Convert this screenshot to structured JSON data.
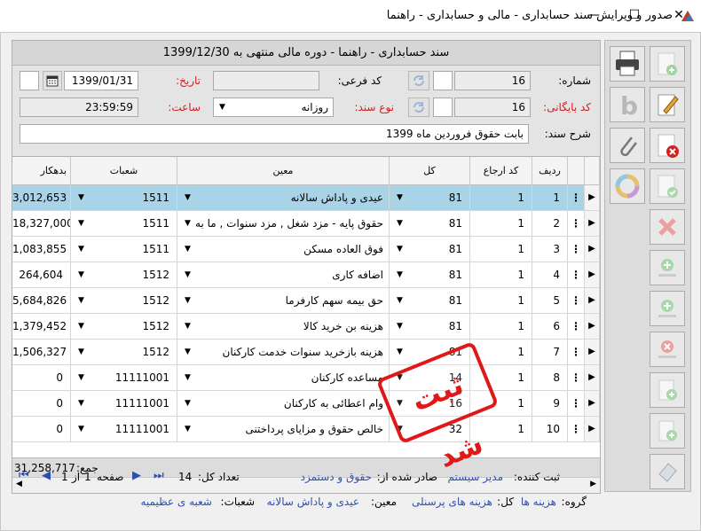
{
  "window": {
    "title": "صدور و ویرایش سند حسابداری - مالی و حسابداری - راهنما",
    "min_glyph": "—",
    "max_glyph": "☐",
    "close_glyph": "✕"
  },
  "header": {
    "title": "سند حسابداری  -  راهنما  -  دوره مالی منتهی به 1399/12/30"
  },
  "form": {
    "number_label": "شماره:",
    "number_value": "16",
    "sub_code_label": "کد فرعی:",
    "sub_code_value": "",
    "date_label": "تاریخ:",
    "date_value": "1399/01/31",
    "archive_label": "کد بایگانی:",
    "archive_value": "16",
    "doc_type_label": "نوع سند:",
    "doc_type_value": "روزانه",
    "time_label": "ساعت:",
    "time_value": "23:59:59",
    "desc_label": "شرح سند:",
    "desc_value": "بابت حقوق فروردین ماه 1399"
  },
  "grid": {
    "columns": {
      "row": "ردیف",
      "ref": "کد ارجاع",
      "kol": "کل",
      "moein": "معین",
      "branch": "شعبات",
      "debit": "بدهکار"
    },
    "rows": [
      {
        "row": "1",
        "ref": "1",
        "kol": "81",
        "moein": "عیدی و پاداش سالانه",
        "branch": "1511",
        "debit": "3,012,653",
        "selected": true
      },
      {
        "row": "2",
        "ref": "1",
        "kol": "81",
        "moein": "حقوق پایه - مزد شغل , مزد سنوات , ما به",
        "branch": "1511",
        "debit": "18,327,000"
      },
      {
        "row": "3",
        "ref": "1",
        "kol": "81",
        "moein": "فوق العاده مسکن",
        "branch": "1511",
        "debit": "1,083,855"
      },
      {
        "row": "4",
        "ref": "1",
        "kol": "81",
        "moein": "اضافه کاری",
        "branch": "1512",
        "debit": "264,604"
      },
      {
        "row": "5",
        "ref": "1",
        "kol": "81",
        "moein": "حق بیمه سهم کارفرما",
        "branch": "1512",
        "debit": "5,684,826"
      },
      {
        "row": "6",
        "ref": "1",
        "kol": "81",
        "moein": "هزینه بن خرید کالا",
        "branch": "1512",
        "debit": "1,379,452"
      },
      {
        "row": "7",
        "ref": "1",
        "kol": "81",
        "moein": "هزینه بازخرید سنوات خدمت کارکنان",
        "branch": "1512",
        "debit": "1,506,327"
      },
      {
        "row": "8",
        "ref": "1",
        "kol": "14",
        "moein": "مساعده کارکنان",
        "branch": "11111001",
        "debit": "0"
      },
      {
        "row": "9",
        "ref": "1",
        "kol": "16",
        "moein": "وام اعطائی به کارکنان",
        "branch": "11111001",
        "debit": "0"
      },
      {
        "row": "10",
        "ref": "1",
        "kol": "32",
        "moein": "خالص حقوق و مزایای پرداختنی",
        "branch": "11111001",
        "debit": "0"
      }
    ],
    "sum_label": "جمع:",
    "sum_value": "31,258,717"
  },
  "stamp": {
    "text": "ثبت شد"
  },
  "footer": {
    "registrar_label": "ثبت کننده:",
    "registrar_value": "مدیر سیستم",
    "issued_from_label": "صادر شده از:",
    "issued_from_value": "حقوق و دستمزد",
    "count_label": "تعداد کل:",
    "count_value": "14",
    "page_label": "صفحه",
    "page_current": "1",
    "page_of": "از",
    "page_total": "1",
    "group_label": "گروه:",
    "group_value": "هزینه ها",
    "kol_label": "کل:",
    "kol_value": "هزینه های پرسنلی",
    "moein_label": "معین:",
    "moein_value": "عیدی و پاداش سالانه",
    "branch_label": "شعبات:",
    "branch_value": "شعبه ی عظیمیه"
  },
  "icons": {
    "toolbar": [
      "printer-icon",
      "add-icon",
      "bold-icon",
      "edit-icon",
      "attach-icon",
      "delete-document-icon",
      "color-wheel-icon",
      "confirm-icon",
      "cancel-icon",
      "add-row-icon",
      "add-row-alt-icon",
      "remove-row-icon",
      "insert-row-icon",
      "insert-row-alt-icon",
      "eraser-icon"
    ]
  },
  "colors": {
    "selected_row": "#a9d3e6",
    "stamp": "#e01818",
    "required_label": "#d02020",
    "link": "#2a4fb4"
  }
}
